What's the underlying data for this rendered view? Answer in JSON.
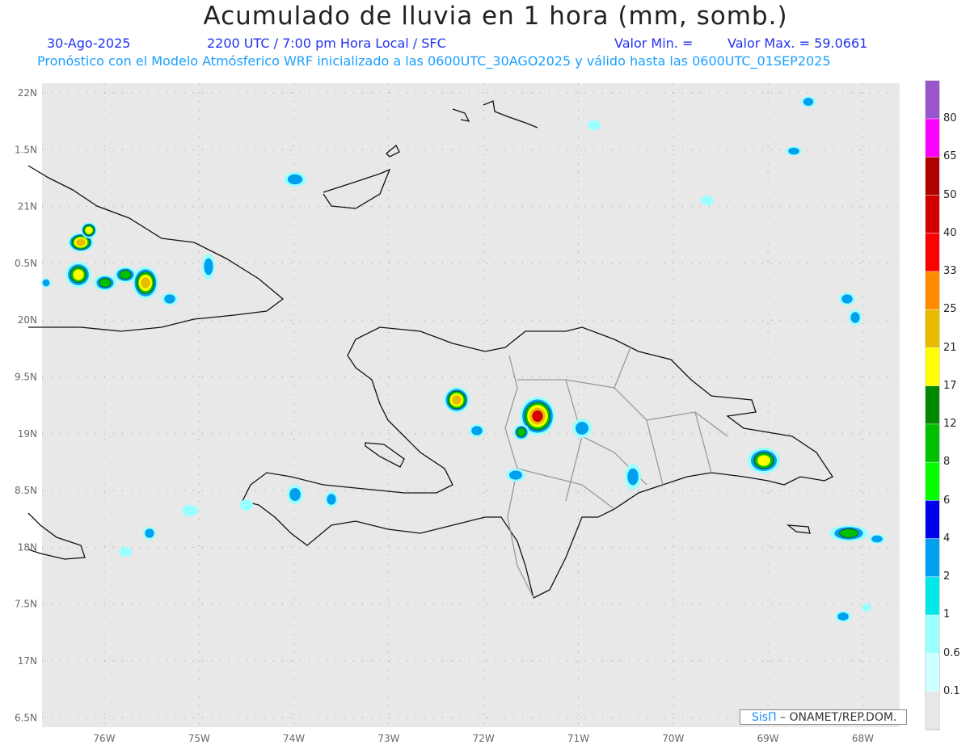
{
  "header": {
    "title": "Acumulado de lluvia en 1 hora (mm, somb.)",
    "date": "30-Ago-2025",
    "time": "2200 UTC / 7:00 pm Hora Local / SFC",
    "min_label": "Valor Min. =",
    "max_label": "Valor Max. = 59.0661",
    "subtitle": "Pronóstico con el Modelo Atmósferico WRF inicializado a las 0600UTC_30AGO2025 y válido hasta las  0600UTC_01SEP2025"
  },
  "axes": {
    "lon_labels": [
      "76W",
      "75W",
      "74W",
      "73W",
      "72W",
      "71W",
      "70W",
      "69W",
      "68W"
    ],
    "lat_labels": [
      "22N",
      "1.5N",
      "21N",
      "0.5N",
      "20N",
      "9.5N",
      "19N",
      "8.5N",
      "18N",
      "7.5N",
      "17N",
      "6.5N"
    ]
  },
  "colorbar": {
    "labels": [
      "80",
      "65",
      "50",
      "40",
      "33",
      "25",
      "21",
      "17",
      "12",
      "8",
      "6",
      "4",
      "2",
      "1",
      "0.6",
      "0.1"
    ],
    "colors": [
      "#9955cc",
      "#ff00ff",
      "#b00000",
      "#d40000",
      "#ff0000",
      "#ff8c00",
      "#e6bb00",
      "#ffff00",
      "#008800",
      "#00c000",
      "#00ff00",
      "#0000ee",
      "#00a0ee",
      "#00e8e8",
      "#99ffff",
      "#ccffff",
      "#e8e8e8"
    ]
  },
  "credit": {
    "logo": "SisΠ",
    "text": " –  ONAMET/REP.DOM."
  }
}
